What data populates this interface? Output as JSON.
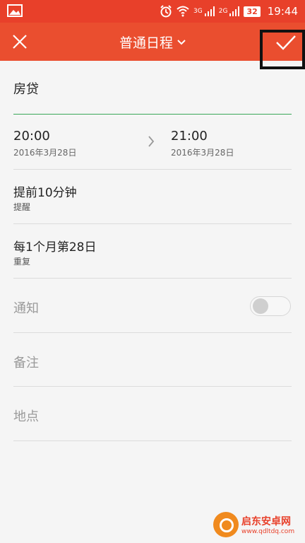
{
  "status_bar": {
    "network_label": "3G",
    "network_label_2": "2G",
    "battery": "32",
    "time": "19:44"
  },
  "app_bar": {
    "title": "普通日程"
  },
  "event": {
    "title": "房贷",
    "start_time": "20:00",
    "start_date": "2016年3月28日",
    "end_time": "21:00",
    "end_date": "2016年3月28日",
    "reminder_value": "提前10分钟",
    "reminder_label": "提醒",
    "repeat_value": "每1个月第28日",
    "repeat_label": "重复",
    "notify_label": "通知",
    "notify_on": false,
    "notes_label": "备注",
    "location_label": "地点"
  },
  "watermark": {
    "name": "启东安卓网",
    "url": "www.qdltdq.com"
  },
  "colors": {
    "accent": "#ea4e2f",
    "underline": "#3aa757"
  }
}
